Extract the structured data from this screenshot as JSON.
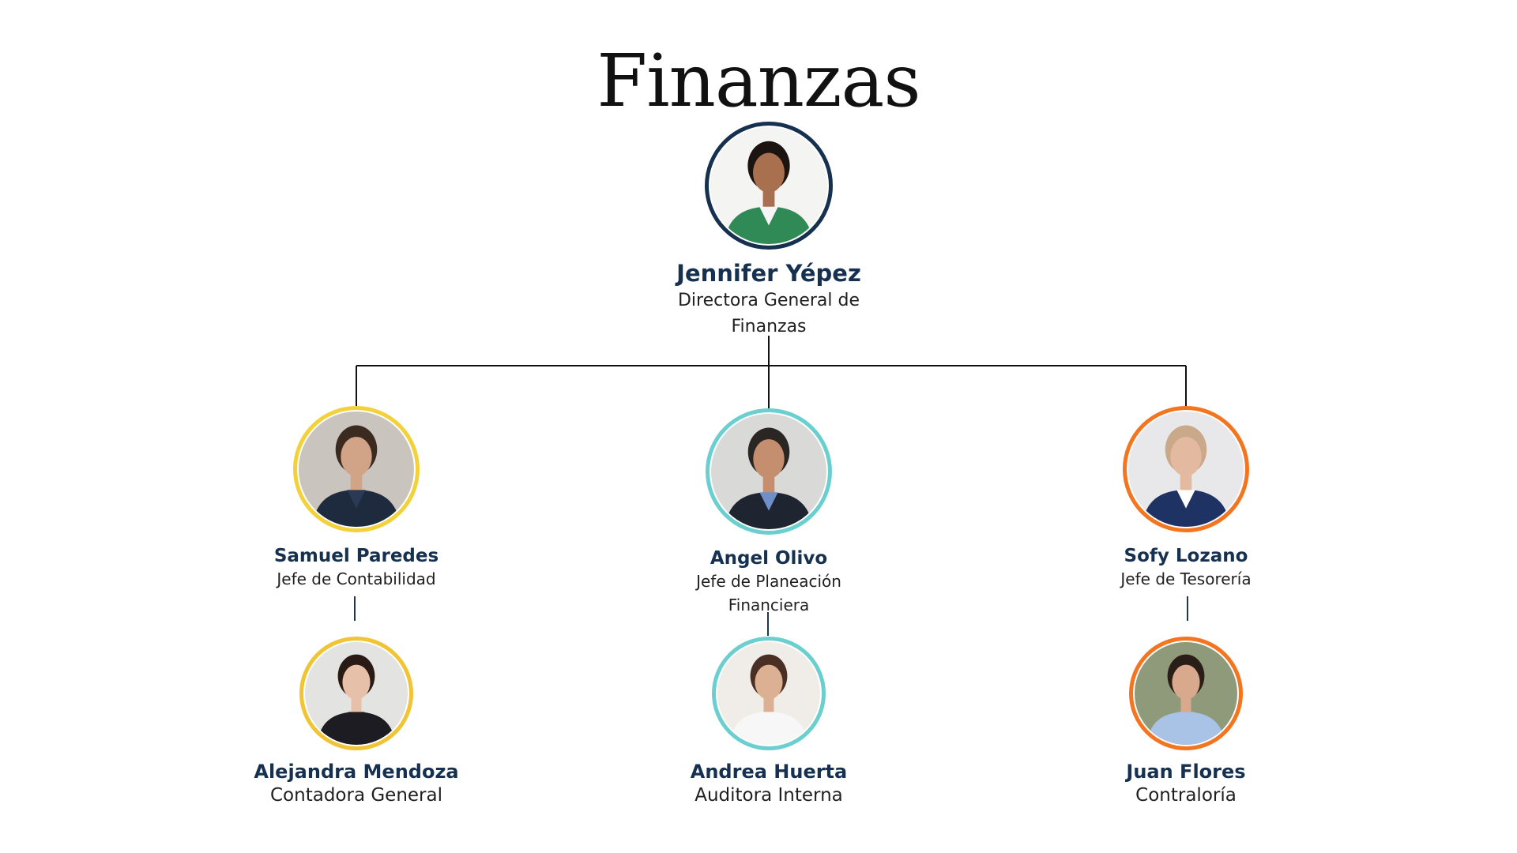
{
  "title": "Finanzas",
  "colors": {
    "name_text": "#16304f",
    "connector": "#111111",
    "sub_connector": "#1f3550"
  },
  "director": {
    "name": "Jennifer Yépez",
    "role": "Directora General de Finanzas",
    "ring_color": "#16304f",
    "photo": {
      "bg": "#f4f4f2",
      "skin": "#a8704e",
      "hair": "#1b1410",
      "outfit": "#2f8a56",
      "shirt": "#f5f5f5"
    }
  },
  "managers": [
    {
      "name": "Samuel Paredes",
      "role": "Jefe de Contabilidad",
      "ring_color": "#f3d13a",
      "photo": {
        "bg": "#c9c4bd",
        "skin": "#d2a487",
        "hair": "#3a2a20",
        "outfit": "#1e2a3e",
        "shirt": "#2a3a55"
      }
    },
    {
      "name": "Angel Olivo",
      "role": "Jefe de Planeación Financiera",
      "ring_color": "#6ccfcf",
      "photo": {
        "bg": "#d9d9d7",
        "skin": "#c58f6f",
        "hair": "#2a2624",
        "outfit": "#1f2530",
        "shirt": "#6f8fc8"
      }
    },
    {
      "name": "Sofy Lozano",
      "role": "Jefe de Tesorería",
      "ring_color": "#f3751f",
      "photo": {
        "bg": "#e8e8ea",
        "skin": "#e3b9a0",
        "hair": "#c9a98a",
        "outfit": "#1f3264",
        "shirt": "#ffffff"
      }
    }
  ],
  "staff": [
    {
      "name": "Alejandra Mendoza",
      "role": "Contadora General",
      "ring_color": "#f0c434",
      "photo": {
        "bg": "#e3e3e1",
        "skin": "#e6c0a8",
        "hair": "#2a1a16",
        "outfit": "#1c1c22",
        "shirt": "#1c1c22"
      }
    },
    {
      "name": "Andrea Huerta",
      "role": "Auditora Interna",
      "ring_color": "#6ccfcf",
      "photo": {
        "bg": "#f0ede8",
        "skin": "#dcb193",
        "hair": "#4a3024",
        "outfit": "#f7f7f7",
        "shirt": "#f7f7f7"
      }
    },
    {
      "name": "Juan Flores",
      "role": "Contraloría",
      "ring_color": "#f3751f",
      "photo": {
        "bg": "#8f9a7a",
        "skin": "#d8a98c",
        "hair": "#2a1e18",
        "outfit": "#a9c3e6",
        "shirt": "#a9c3e6"
      }
    }
  ]
}
